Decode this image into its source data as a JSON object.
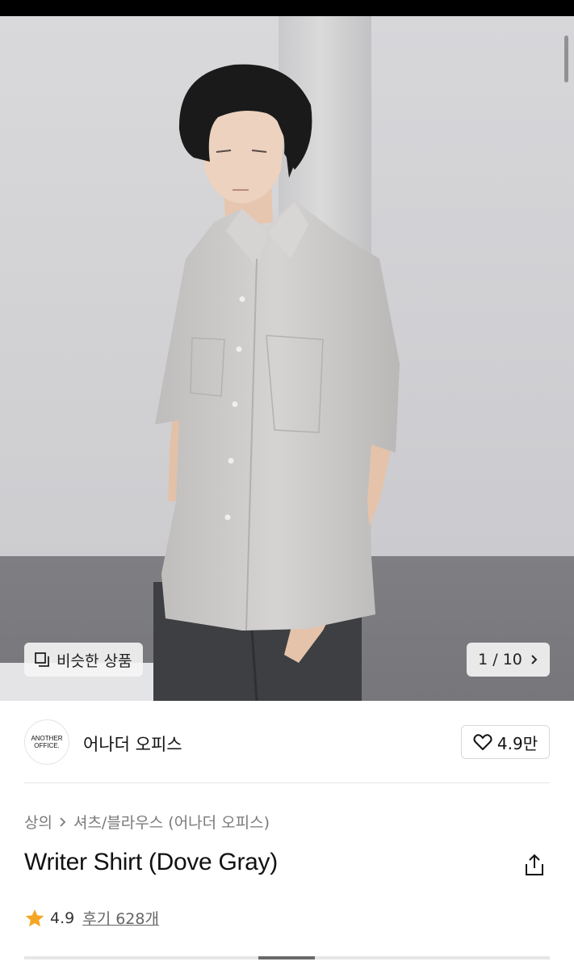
{
  "gallery": {
    "similar_label": "비슷한 상품",
    "page_indicator": "1 / 10",
    "current_page": 1,
    "total_pages": 10
  },
  "brand": {
    "logo_text": "ANOTHER OFFICE.",
    "name": "어나더 오피스",
    "likes": "4.9만"
  },
  "breadcrumb": {
    "items": [
      "상의",
      "셔츠/블라우스 (어나더 오피스)"
    ]
  },
  "product": {
    "title": "Writer Shirt (Dove Gray)"
  },
  "rating": {
    "score": "4.9",
    "reviews_label": "후기 628개"
  },
  "colors": {
    "star": "#f5a623",
    "text": "#111111",
    "muted": "#7a7a7a"
  }
}
